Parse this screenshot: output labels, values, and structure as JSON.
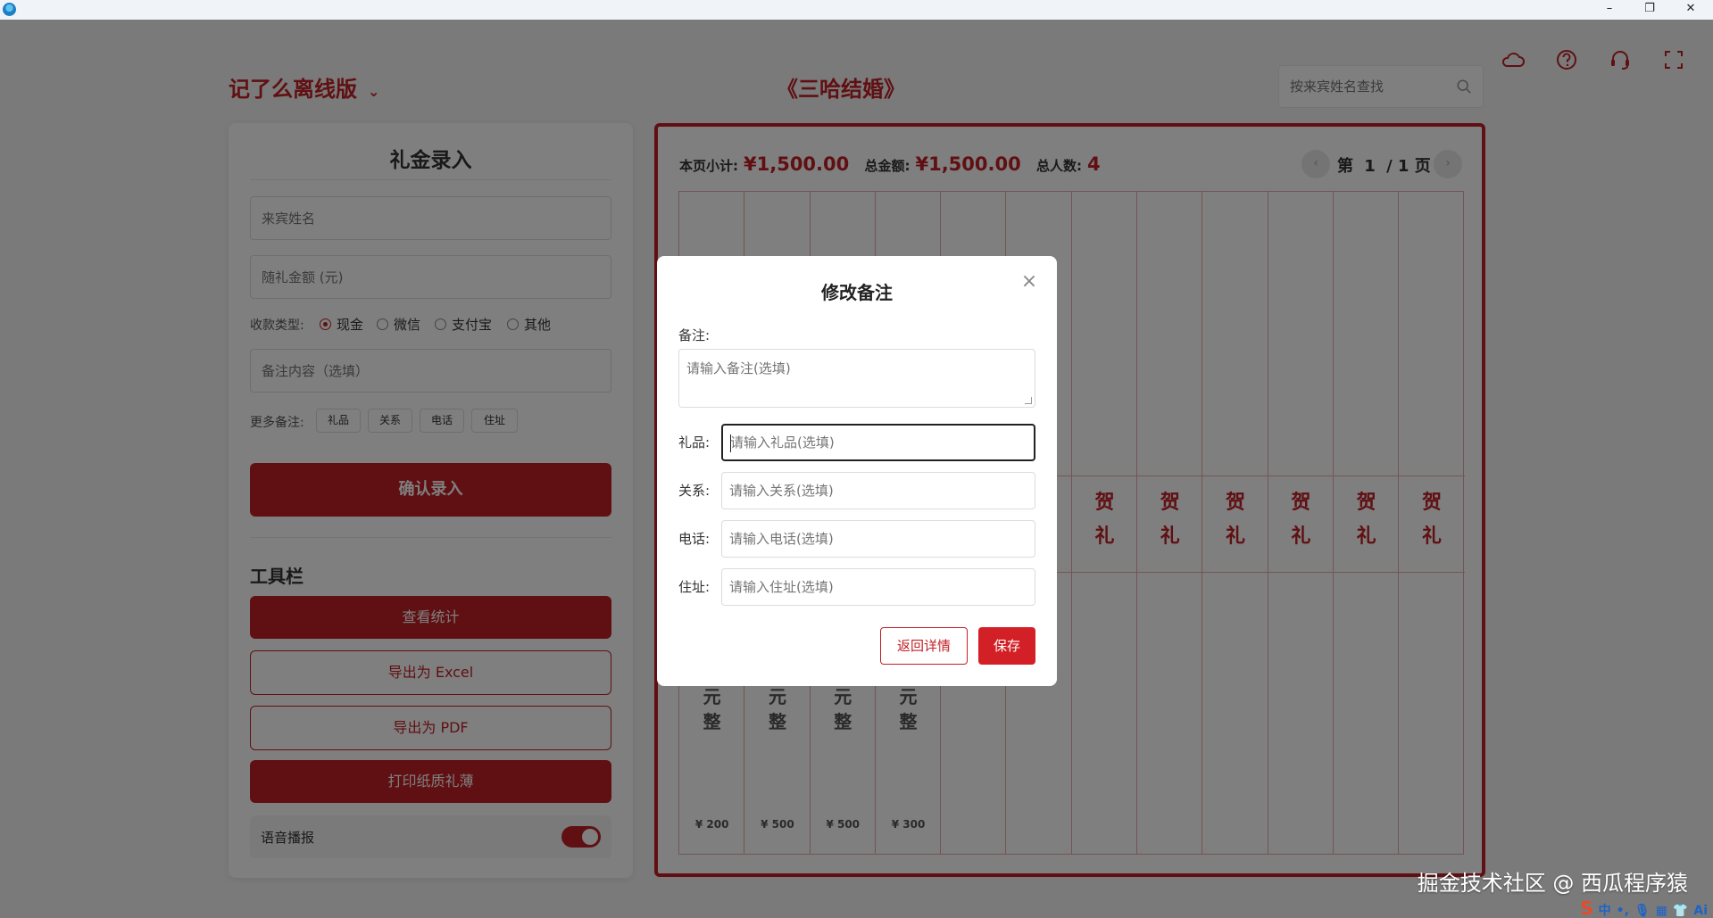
{
  "window": {
    "icon": "app-globe-icon",
    "controls": [
      "–",
      "❐",
      "✕"
    ]
  },
  "header": {
    "brand": "记了么离线版",
    "event_title": "《三哈结婚》",
    "search_placeholder": "按来宾姓名查找",
    "icons": [
      "cloud-icon",
      "help-icon",
      "headset-icon",
      "fullscreen-icon"
    ]
  },
  "entry": {
    "title": "礼金录入",
    "name_placeholder": "来宾姓名",
    "amount_placeholder": "随礼金额 (元)",
    "payment_label": "收款类型:",
    "payment_options": [
      "现金",
      "微信",
      "支付宝",
      "其他"
    ],
    "payment_selected": "现金",
    "note_placeholder": "备注内容（选填）",
    "more_label": "更多备注:",
    "more_chips": [
      "礼品",
      "关系",
      "电话",
      "住址"
    ],
    "confirm_label": "确认录入"
  },
  "tools": {
    "title": "工具栏",
    "stats_label": "查看统计",
    "excel_label": "导出为 Excel",
    "pdf_label": "导出为 PDF",
    "print_label": "打印纸质礼薄",
    "voice_label": "语音播报",
    "voice_on": true
  },
  "ledger": {
    "page_subtotal_label": "本页小计:",
    "page_subtotal": "¥1,500.00",
    "total_label": "总金额:",
    "total": "¥1,500.00",
    "count_label": "总人数:",
    "count": "4",
    "pager_prefix": "第",
    "current_page": "1",
    "pager_suffix": "/ 1 页",
    "prev": "‹",
    "next": "›",
    "columns": [
      {
        "gift": "",
        "amount_chars": "元\n整",
        "amount": "¥ 200"
      },
      {
        "gift": "",
        "amount_chars": "元\n整",
        "amount": "¥ 500"
      },
      {
        "gift": "",
        "amount_chars": "元\n整",
        "amount": "¥ 500"
      },
      {
        "gift": "",
        "amount_chars": "元\n整",
        "amount": "¥ 300"
      },
      {
        "gift": "",
        "amount_chars": "",
        "amount": ""
      },
      {
        "gift": "",
        "amount_chars": "",
        "amount": ""
      },
      {
        "gift": "贺\n礼",
        "amount_chars": "",
        "amount": ""
      },
      {
        "gift": "贺\n礼",
        "amount_chars": "",
        "amount": ""
      },
      {
        "gift": "贺\n礼",
        "amount_chars": "",
        "amount": ""
      },
      {
        "gift": "贺\n礼",
        "amount_chars": "",
        "amount": ""
      },
      {
        "gift": "贺\n礼",
        "amount_chars": "",
        "amount": ""
      },
      {
        "gift": "贺\n礼",
        "amount_chars": "",
        "amount": ""
      }
    ]
  },
  "modal": {
    "title": "修改备注",
    "close": "×",
    "note_label": "备注:",
    "note_placeholder": "请输入备注(选填)",
    "gift_label": "礼品:",
    "gift_placeholder": "请输入礼品(选填)",
    "relation_label": "关系:",
    "relation_placeholder": "请输入关系(选填)",
    "phone_label": "电话:",
    "phone_placeholder": "请输入电话(选填)",
    "address_label": "住址:",
    "address_placeholder": "请输入住址(选填)",
    "back_label": "返回详情",
    "save_label": "保存"
  },
  "watermark": "掘金技术社区 @ 西瓜程序猿",
  "tray": [
    "S",
    "中",
    "•,",
    "🎙",
    "▦",
    "👕",
    "Ai"
  ],
  "colors": {
    "accent": "#c02026",
    "grid": "#e9a8aa"
  }
}
